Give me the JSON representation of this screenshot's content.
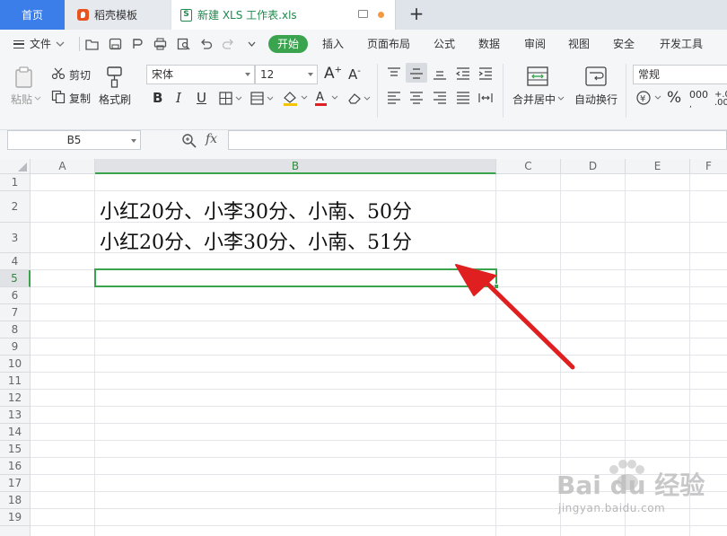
{
  "tabs": {
    "home": "首页",
    "template": "稻壳模板",
    "file": "新建 XLS 工作表.xls",
    "new_tab": "+"
  },
  "menu": {
    "file": "文件",
    "items": [
      "开始",
      "插入",
      "页面布局",
      "公式",
      "数据",
      "审阅",
      "视图",
      "安全",
      "开发工具"
    ]
  },
  "toolbar": {
    "paste": "粘贴",
    "cut": "剪切",
    "copy": "复制",
    "format_painter": "格式刷",
    "font_name": "宋体",
    "font_size": "12",
    "merge_center": "合并居中",
    "wrap_text": "自动换行",
    "number_format": "常规"
  },
  "formula_bar": {
    "cell_ref": "B5",
    "fx": "fx",
    "value": ""
  },
  "sheet": {
    "columns": [
      "A",
      "B",
      "C",
      "D",
      "E",
      "F"
    ],
    "rows": [
      "1",
      "2",
      "3",
      "4",
      "5",
      "6",
      "7",
      "8",
      "9",
      "10",
      "11",
      "12",
      "13",
      "14",
      "15",
      "16",
      "17",
      "18",
      "19"
    ],
    "selected_cell": "B5",
    "cells": {
      "B2": "小红20分、小李30分、小南、50分",
      "B3": "小红20分、小李30分、小南、51分"
    }
  },
  "watermark": {
    "brand": "Bai du 经验",
    "url": "jingyan.baidu.com"
  },
  "colors": {
    "accent_green": "#3aa34e",
    "tab_blue": "#3b7de9",
    "arrow_red": "#e02020"
  }
}
